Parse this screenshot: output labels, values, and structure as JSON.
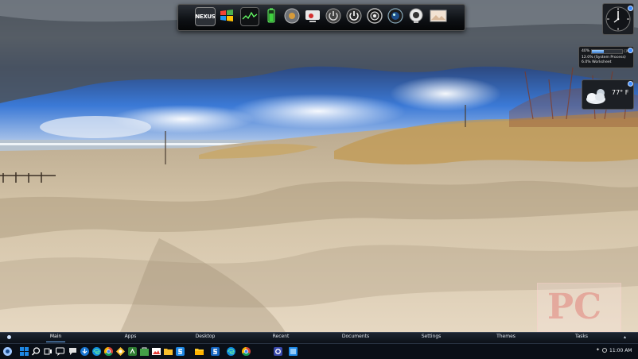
{
  "colors": {
    "menu_accent": "#6fb4ff",
    "taskbar_bg": "#0a0f17",
    "windows_blue": "#1e88e5"
  },
  "top_dock": {
    "items": [
      {
        "name": "nexus-logo",
        "label": "NEXUS"
      },
      {
        "name": "windows-flag-icon"
      },
      {
        "name": "performance-monitor-icon"
      },
      {
        "name": "battery-icon"
      },
      {
        "name": "system-settings-icon"
      },
      {
        "name": "computer-icon"
      },
      {
        "name": "shutdown-icon"
      },
      {
        "name": "power-icon"
      },
      {
        "name": "speaker-icon"
      },
      {
        "name": "camera-icon"
      },
      {
        "name": "webcam-icon"
      },
      {
        "name": "photos-icon"
      }
    ]
  },
  "cpu_gadget": {
    "percent_label": "40%",
    "cpu_fill": 0.4,
    "tag": "CPU",
    "line1": "12.0% (System Process)",
    "line2": "6.0% Worksheet"
  },
  "weather_gadget": {
    "temperature": "77° F",
    "icon": "partly-cloudy-icon"
  },
  "watermark": {
    "text": "PC"
  },
  "menu_bar": {
    "tabs": [
      {
        "label": "Main"
      },
      {
        "label": "Apps"
      },
      {
        "label": "Desktop"
      },
      {
        "label": "Recent"
      },
      {
        "label": "Documents"
      },
      {
        "label": "Settings"
      },
      {
        "label": "Themes"
      },
      {
        "label": "Tasks"
      }
    ]
  },
  "taskbar": {
    "icons": [
      "nexus-start-icon",
      "windows-start-icon",
      "search-icon",
      "task-view-icon",
      "chat-icon",
      "speech-icon",
      "download-icon",
      "edge-icon",
      "chrome-icon",
      "notes-icon",
      "green-app-icon",
      "store-icon",
      "photos-icon",
      "folder-icon",
      "snagit-icon",
      "file-explorer-icon",
      "snagit-icon-2",
      "edge-icon-2",
      "chrome-icon-2",
      "settings-icon",
      "app-icon"
    ],
    "time": "11:00 AM"
  }
}
